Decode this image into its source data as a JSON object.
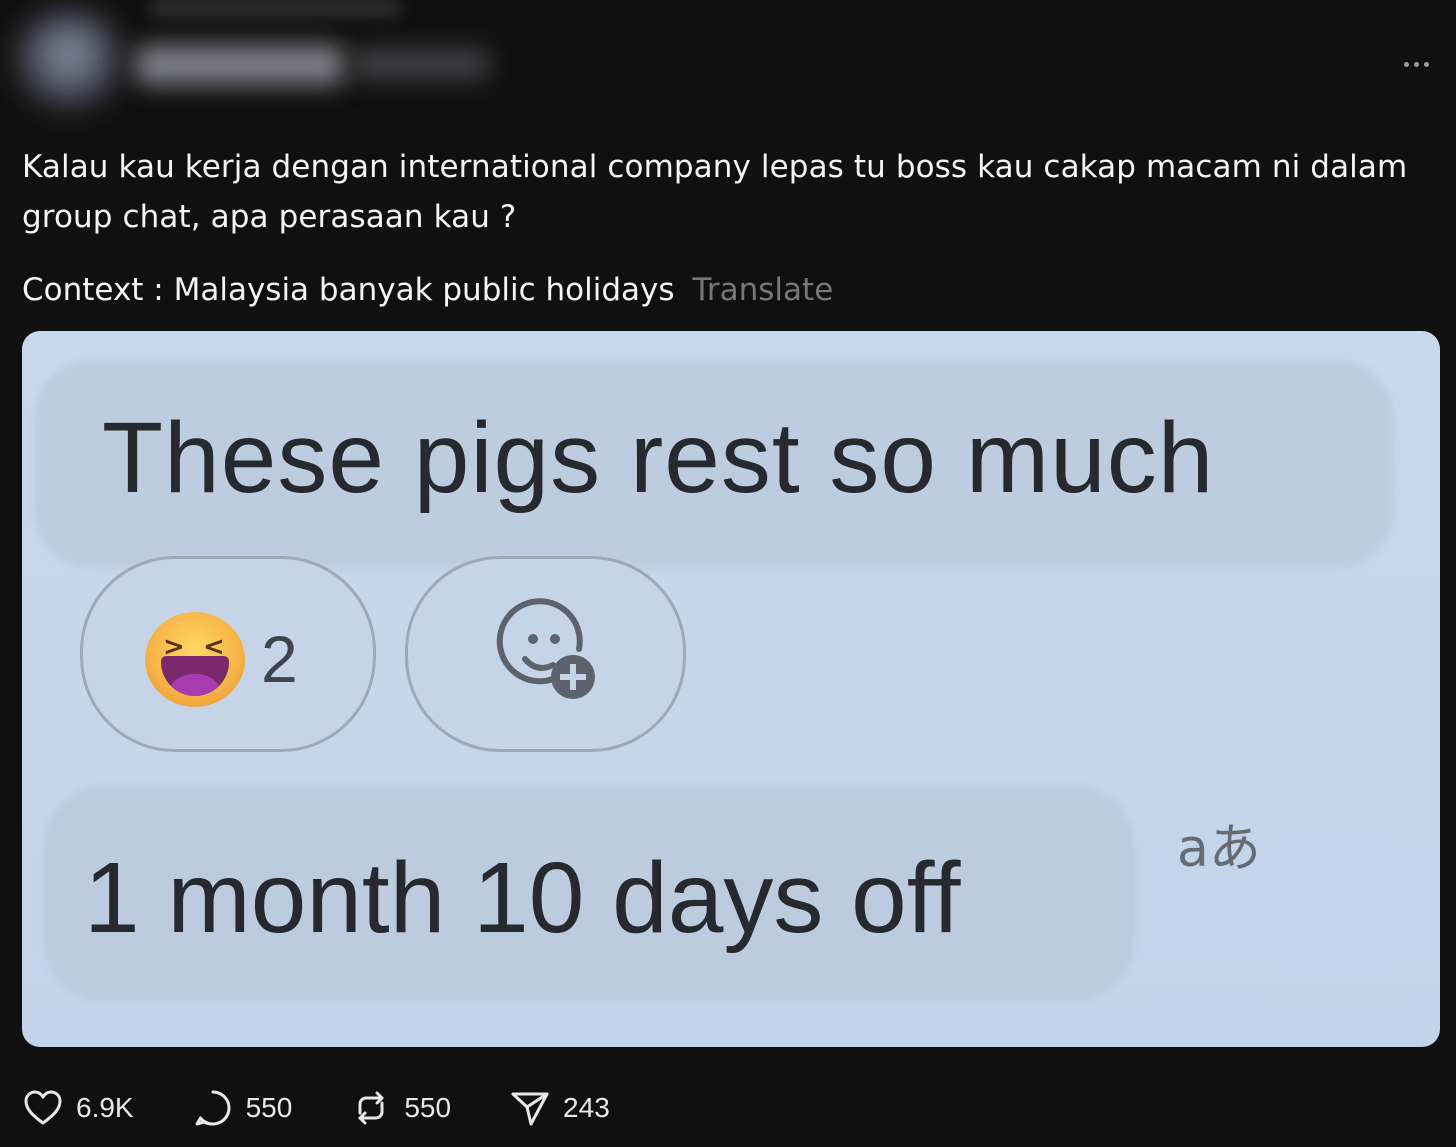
{
  "post": {
    "body": "Kalau kau kerja dengan international company lepas tu boss kau cakap macam ni dalam group chat, apa perasaan kau ?",
    "context": "Context : Malaysia banyak public holidays",
    "translate_label": "Translate"
  },
  "media": {
    "message1": "These pigs rest so much",
    "reaction_count": "2",
    "message2": "1 month 10 days off",
    "translate_glyph": "aあ"
  },
  "actions": {
    "likes": "6.9K",
    "replies": "550",
    "reposts": "550",
    "shares": "243"
  },
  "icons": {
    "more": "more-horizontal-icon",
    "like": "heart-icon",
    "reply": "comment-icon",
    "repost": "repost-icon",
    "share": "send-icon",
    "reaction_emoji": "laughing-squinting-face-emoji",
    "add_reaction": "add-reaction-icon"
  }
}
